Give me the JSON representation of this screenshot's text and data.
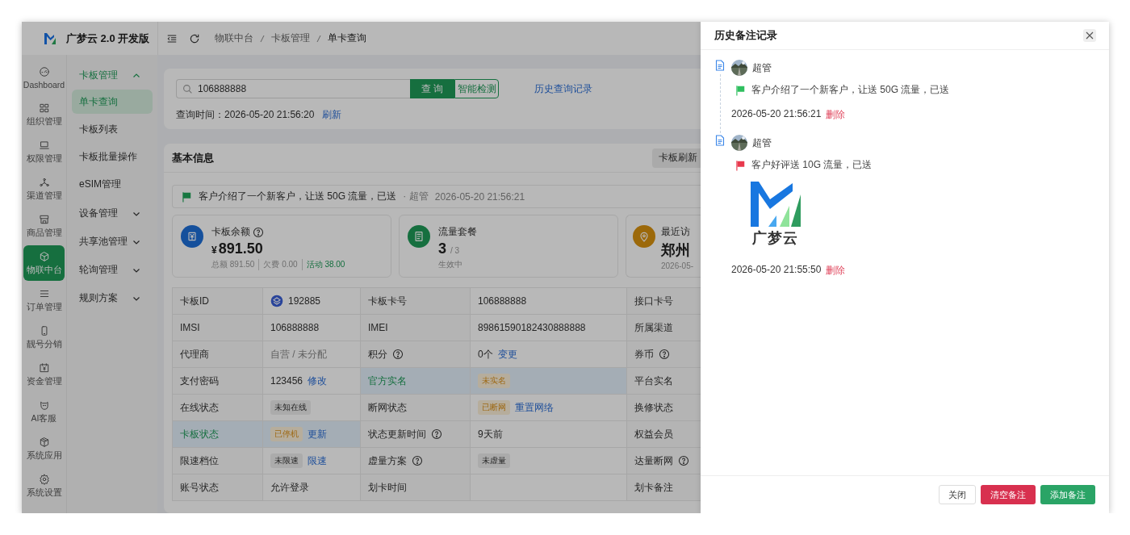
{
  "app": {
    "name": "广梦云 2.0 开发版"
  },
  "rail": [
    {
      "label": "Dashboard",
      "selected": false
    },
    {
      "label": "组织管理",
      "selected": false
    },
    {
      "label": "权限管理",
      "selected": false
    },
    {
      "label": "渠道管理",
      "selected": false
    },
    {
      "label": "商品管理",
      "selected": false
    },
    {
      "label": "物联中台",
      "selected": true
    },
    {
      "label": "订单管理",
      "selected": false
    },
    {
      "label": "靓号分销",
      "selected": false
    },
    {
      "label": "资金管理",
      "selected": false
    },
    {
      "label": "AI客服",
      "selected": false
    },
    {
      "label": "系统应用",
      "selected": false
    },
    {
      "label": "系统设置",
      "selected": false
    }
  ],
  "menu": [
    {
      "label": "卡板管理",
      "expanded": true,
      "children": [
        {
          "label": "单卡查询",
          "selected": true
        },
        {
          "label": "卡板列表",
          "selected": false
        },
        {
          "label": "卡板批量操作",
          "selected": false
        },
        {
          "label": "eSIM管理",
          "selected": false
        }
      ]
    },
    {
      "label": "设备管理",
      "expanded": false
    },
    {
      "label": "共享池管理",
      "expanded": false
    },
    {
      "label": "轮询管理",
      "expanded": false
    },
    {
      "label": "规则方案",
      "expanded": false
    }
  ],
  "breadcrumb": [
    "物联中台",
    "卡板管理",
    "单卡查询"
  ],
  "search": {
    "value": "106888888",
    "query_button": "查 询",
    "detect_button": "智能检测",
    "history_link": "历史查询记录",
    "time_label": "查询时间：",
    "time": "2026-05-20 21:56:20",
    "refresh_link": "刷新"
  },
  "basic_info": {
    "title": "基本信息",
    "refresh_button": "卡板刷新",
    "note": {
      "text": "客户介绍了一个新客户，让送 50G 流量，已送",
      "author": "· 超管",
      "time": "2026-05-20 21:56:21"
    },
    "stats": [
      {
        "kind": "balance",
        "title": "卡板余额",
        "help": true,
        "currency": "¥",
        "value": "891.50",
        "details": [
          {
            "text": "总额 891.50",
            "highlight": false
          },
          {
            "text": "欠费 0.00",
            "highlight": false
          },
          {
            "text": "活动 38.00",
            "highlight": true
          }
        ]
      },
      {
        "kind": "plan",
        "title": "流量套餐",
        "value": "3",
        "total": "/ 3",
        "subtitle": "生效中"
      },
      {
        "kind": "location",
        "title": "最近访",
        "value": "郑州",
        "subtitle": "2026-05-"
      }
    ],
    "table": {
      "rows": [
        [
          {
            "kind": "label",
            "text": "卡板ID",
            "highlighted": false
          },
          {
            "kind": "carrier",
            "text": "192885",
            "highlighted": false
          },
          {
            "kind": "label",
            "text": "卡板卡号",
            "highlighted": false
          },
          {
            "kind": "value",
            "text": "106888888",
            "highlighted": false
          },
          {
            "kind": "label",
            "text": "接口卡号",
            "highlighted": false
          }
        ],
        [
          {
            "kind": "label",
            "text": "IMSI",
            "highlighted": false
          },
          {
            "kind": "value",
            "text": "106888888",
            "highlighted": false
          },
          {
            "kind": "label",
            "text": "IMEI",
            "highlighted": false
          },
          {
            "kind": "value",
            "text": "89861590182430888888",
            "highlighted": false
          },
          {
            "kind": "label",
            "text": "所属渠道",
            "highlighted": false
          }
        ],
        [
          {
            "kind": "label",
            "text": "代理商",
            "highlighted": false
          },
          {
            "kind": "muted",
            "text": "自营 / 未分配",
            "highlighted": false
          },
          {
            "kind": "label",
            "text": "积分",
            "help": true,
            "highlighted": false
          },
          {
            "kind": "value",
            "text": "0个",
            "link": "变更",
            "highlighted": false
          },
          {
            "kind": "label",
            "text": "券币",
            "help": true,
            "highlighted": false
          }
        ],
        [
          {
            "kind": "label",
            "text": "支付密码",
            "highlighted": false
          },
          {
            "kind": "value",
            "text": "123456",
            "link": "修改",
            "highlighted": false
          },
          {
            "kind": "label",
            "text": "官方实名",
            "highlighted": true
          },
          {
            "kind": "value",
            "tag": {
              "text": "未实名",
              "kind": "warning"
            },
            "highlighted": true
          },
          {
            "kind": "label",
            "text": "平台实名",
            "highlighted": false
          }
        ],
        [
          {
            "kind": "label",
            "text": "在线状态",
            "highlighted": false
          },
          {
            "kind": "value",
            "tag": {
              "text": "未知在线",
              "kind": "neutral"
            },
            "highlighted": false
          },
          {
            "kind": "label",
            "text": "断网状态",
            "highlighted": false
          },
          {
            "kind": "value",
            "tag": {
              "text": "已断网",
              "kind": "warning"
            },
            "link": "重置网络",
            "highlighted": false
          },
          {
            "kind": "label",
            "text": "换修状态",
            "highlighted": false
          }
        ],
        [
          {
            "kind": "label",
            "text": "卡板状态",
            "highlighted": true
          },
          {
            "kind": "value",
            "tag": {
              "text": "已停机",
              "kind": "warning"
            },
            "link": "更新",
            "highlighted": true
          },
          {
            "kind": "label",
            "text": "状态更新时间",
            "help": true,
            "highlighted": false
          },
          {
            "kind": "value",
            "text": "9天前",
            "highlighted": false
          },
          {
            "kind": "label",
            "text": "权益会员",
            "highlighted": false
          }
        ],
        [
          {
            "kind": "label",
            "text": "限速档位",
            "highlighted": false
          },
          {
            "kind": "value",
            "tag": {
              "text": "未限速",
              "kind": "neutral"
            },
            "link": "限速",
            "highlighted": false
          },
          {
            "kind": "label",
            "text": "虚量方案",
            "help": true,
            "highlighted": false
          },
          {
            "kind": "value",
            "tag": {
              "text": "未虚量",
              "kind": "neutral"
            },
            "highlighted": false
          },
          {
            "kind": "label",
            "text": "达量断网",
            "help": true,
            "highlighted": false
          }
        ],
        [
          {
            "kind": "label",
            "text": "账号状态",
            "highlighted": false
          },
          {
            "kind": "value",
            "text": "允许登录",
            "highlighted": false
          },
          {
            "kind": "label",
            "text": "划卡时间",
            "highlighted": false
          },
          {
            "kind": "value",
            "highlighted": false
          },
          {
            "kind": "label",
            "text": "划卡备注",
            "highlighted": false
          }
        ]
      ]
    }
  },
  "drawer": {
    "title": "历史备注记录",
    "notes": [
      {
        "author": "超管",
        "color": "#2fbf5f",
        "text": "客户介绍了一个新客户，让送 50G 流量，已送",
        "time": "2026-05-20 21:56:21",
        "delete_link": "删除"
      },
      {
        "author": "超管",
        "color": "#e8394d",
        "text": "客户好评送 10G 流量，已送",
        "attachment": {
          "caption": "广梦云"
        },
        "time": "2026-05-20 21:55:50",
        "delete_link": "删除"
      }
    ],
    "buttons": [
      {
        "label": "关闭",
        "kind": "default"
      },
      {
        "label": "清空备注",
        "kind": "danger"
      },
      {
        "label": "添加备注",
        "kind": "primary"
      }
    ]
  }
}
